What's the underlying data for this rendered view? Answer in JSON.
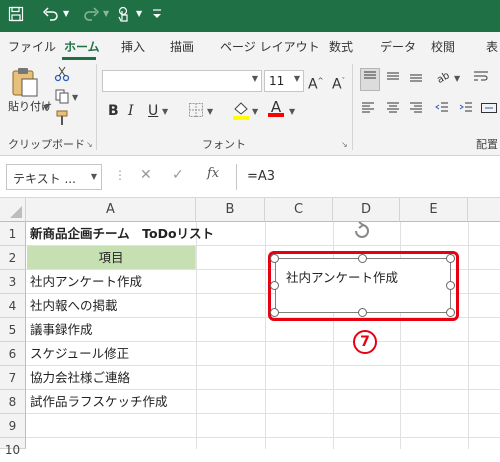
{
  "qat": {
    "save_icon": "save-icon",
    "undo_icon": "undo-icon",
    "redo_icon": "redo-icon",
    "touch_icon": "touch-mode-icon",
    "customize_icon": "customize-qat-icon"
  },
  "tabs": [
    "ファイル",
    "ホーム",
    "挿入",
    "描画",
    "ページ レイアウト",
    "数式",
    "データ",
    "校閲",
    "表"
  ],
  "active_tab": "ホーム",
  "ribbon": {
    "paste_label": "貼り付け",
    "clipboard_label": "クリップボード",
    "font_label": "フォント",
    "font_name": "",
    "font_size": "11",
    "grow_font": "A^",
    "shrink_font": "Aˇ",
    "bold": "B",
    "italic": "I",
    "underline": "U",
    "font_color": "A",
    "alignment_label": "配置",
    "fill_color": "#ffff00",
    "text_color": "#ff0000"
  },
  "formula_bar": {
    "name_box": "テキスト ...",
    "fx": "fx",
    "formula": "=A3"
  },
  "columns": [
    "A",
    "B",
    "C",
    "D",
    "E"
  ],
  "rows": [
    "1",
    "2",
    "3",
    "4",
    "5",
    "6",
    "7",
    "8",
    "9",
    "10"
  ],
  "cells": {
    "A1": "新商品企画チーム　ToDoリスト",
    "A2": "項目",
    "A3": "社内アンケート作成",
    "A4": "社内報への掲載",
    "A5": "議事録作成",
    "A6": "スケジュール修正",
    "A7": "協力会社様ご連絡",
    "A8": "試作品ラフスケッチ作成"
  },
  "shape": {
    "text": "社内アンケート作成"
  },
  "callout": "7",
  "colors": {
    "accent": "#1f7145",
    "header_fill": "#c6e0b4",
    "highlight": "#e60012"
  }
}
